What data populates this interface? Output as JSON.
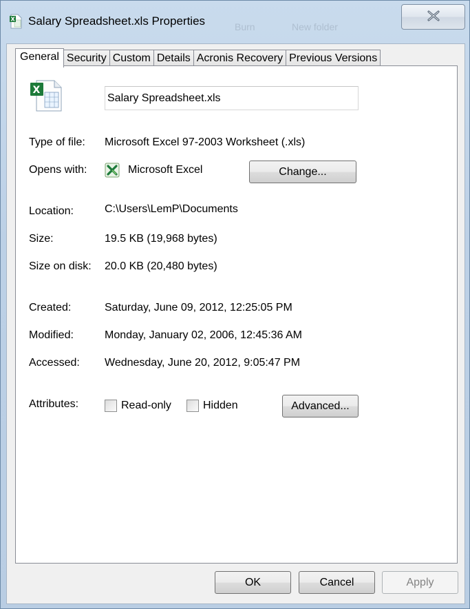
{
  "window": {
    "title": "Salary Spreadsheet.xls Properties",
    "background_ghost": [
      "Burn",
      "New folder"
    ]
  },
  "tabs": [
    {
      "label": "General",
      "active": true
    },
    {
      "label": "Security",
      "active": false
    },
    {
      "label": "Custom",
      "active": false
    },
    {
      "label": "Details",
      "active": false
    },
    {
      "label": "Acronis Recovery",
      "active": false
    },
    {
      "label": "Previous Versions",
      "active": false
    }
  ],
  "general": {
    "file_name": "Salary Spreadsheet.xls",
    "type_label": "Type of file:",
    "type_value": "Microsoft Excel 97-2003 Worksheet (.xls)",
    "opens_label": "Opens with:",
    "opens_value": "Microsoft Excel",
    "change_label": "Change...",
    "location_label": "Location:",
    "location_value": "C:\\Users\\LemP\\Documents",
    "size_label": "Size:",
    "size_value": "19.5 KB (19,968 bytes)",
    "size_disk_label": "Size on disk:",
    "size_disk_value": "20.0 KB (20,480 bytes)",
    "created_label": "Created:",
    "created_value": "Saturday, June 09, 2012, 12:25:05 PM",
    "modified_label": "Modified:",
    "modified_value": "Monday, January 02, 2006, 12:45:36 AM",
    "accessed_label": "Accessed:",
    "accessed_value": "Wednesday, June 20, 2012, 9:05:47 PM",
    "attributes_label": "Attributes:",
    "readonly_label": "Read-only",
    "readonly_checked": false,
    "hidden_label": "Hidden",
    "hidden_checked": false,
    "advanced_label": "Advanced..."
  },
  "footer": {
    "ok_label": "OK",
    "cancel_label": "Cancel",
    "apply_label": "Apply"
  },
  "icons": {
    "file": "excel-file-icon",
    "app": "excel-app-icon",
    "close": "close-icon"
  },
  "colors": {
    "excel_green": "#1d7a3a",
    "frame": "#bcd0e6"
  }
}
